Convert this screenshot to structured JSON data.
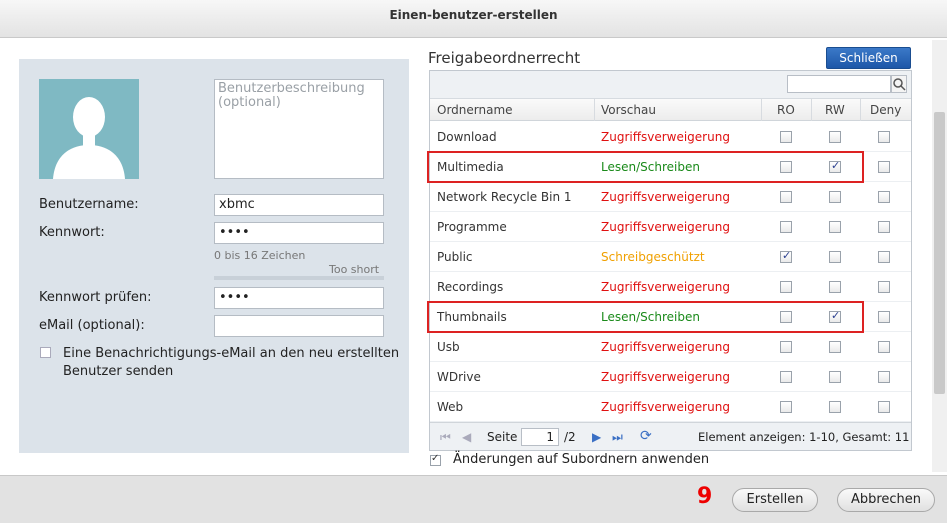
{
  "window": {
    "title": "Einen-benutzer-erstellen"
  },
  "form": {
    "description_placeholder": "Benutzerbeschreibung (optional)",
    "username_label": "Benutzername:",
    "username_value": "xbmc",
    "password_label": "Kennwort:",
    "password_value": "••••",
    "password_hint": "0 bis 16 Zeichen",
    "password_strength": "Too short",
    "password_confirm_label": "Kennwort prüfen:",
    "password_confirm_value": "••••",
    "email_label": "eMail (optional):",
    "email_value": "",
    "notify_label": "Eine Benachrichtigungs-eMail an den neu erstellten Benutzer senden"
  },
  "shares": {
    "title": "Freigabeordnerrecht",
    "close_button": "Schließen",
    "columns": {
      "name": "Ordnername",
      "preview": "Vorschau",
      "ro": "RO",
      "rw": "RW",
      "deny": "Deny"
    },
    "rows": [
      {
        "name": "Download",
        "preview": "Zugriffsverweigerung",
        "preview_color": "#e01010",
        "ro": false,
        "rw": false,
        "deny": false
      },
      {
        "name": "Multimedia",
        "preview": "Lesen/Schreiben",
        "preview_color": "#1a8a1a",
        "ro": false,
        "rw": true,
        "deny": false
      },
      {
        "name": "Network Recycle Bin 1",
        "preview": "Zugriffsverweigerung",
        "preview_color": "#e01010",
        "ro": false,
        "rw": false,
        "deny": false
      },
      {
        "name": "Programme",
        "preview": "Zugriffsverweigerung",
        "preview_color": "#e01010",
        "ro": false,
        "rw": false,
        "deny": false
      },
      {
        "name": "Public",
        "preview": "Schreibgeschützt",
        "preview_color": "#f0a000",
        "ro": true,
        "rw": false,
        "deny": false
      },
      {
        "name": "Recordings",
        "preview": "Zugriffsverweigerung",
        "preview_color": "#e01010",
        "ro": false,
        "rw": false,
        "deny": false
      },
      {
        "name": "Thumbnails",
        "preview": "Lesen/Schreiben",
        "preview_color": "#1a8a1a",
        "ro": false,
        "rw": true,
        "deny": false
      },
      {
        "name": "Usb",
        "preview": "Zugriffsverweigerung",
        "preview_color": "#e01010",
        "ro": false,
        "rw": false,
        "deny": false
      },
      {
        "name": "WDrive",
        "preview": "Zugriffsverweigerung",
        "preview_color": "#e01010",
        "ro": false,
        "rw": false,
        "deny": false
      },
      {
        "name": "Web",
        "preview": "Zugriffsverweigerung",
        "preview_color": "#e01010",
        "ro": false,
        "rw": false,
        "deny": false
      }
    ],
    "pager": {
      "page_label": "Seite",
      "page_value": "1",
      "page_total": "/2",
      "summary": "Element anzeigen: 1-10, Gesamt: 11"
    },
    "apply_subfolders_label": "Änderungen auf Subordnern anwenden"
  },
  "footer": {
    "step_number": "9",
    "create_button": "Erstellen",
    "cancel_button": "Abbrechen"
  }
}
